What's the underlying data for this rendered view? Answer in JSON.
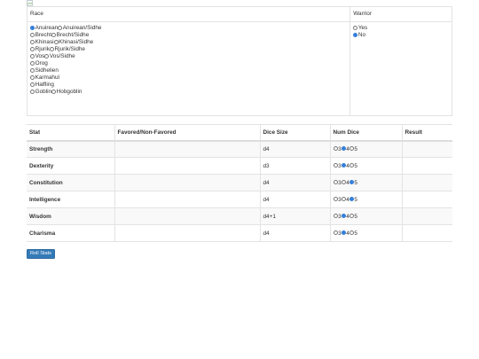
{
  "race_panel": {
    "race_header": "Race",
    "warrior_header": "Warrior",
    "race_rows": [
      [
        {
          "label": "Anuirean",
          "checked": true
        },
        {
          "label": "Anuirean/Sidhe",
          "checked": false
        }
      ],
      [
        {
          "label": "Brecht",
          "checked": false
        },
        {
          "label": "Brecht/Sidhe",
          "checked": false
        }
      ],
      [
        {
          "label": "Khinasi",
          "checked": false
        },
        {
          "label": "Khinasi/Sidhe",
          "checked": false
        }
      ],
      [
        {
          "label": "Rjurik",
          "checked": false
        },
        {
          "label": "Rjurik/Sidhe",
          "checked": false
        }
      ],
      [
        {
          "label": "Vos",
          "checked": false
        },
        {
          "label": "Vos/Sidhe",
          "checked": false
        }
      ],
      [
        {
          "label": "Orog",
          "checked": false
        }
      ],
      [
        {
          "label": "Sidhelien",
          "checked": false
        }
      ],
      [
        {
          "label": "Karmahul",
          "checked": false
        }
      ],
      [
        {
          "label": "Halfling",
          "checked": false
        }
      ],
      [
        {
          "label": "Goblin",
          "checked": false
        },
        {
          "label": "Hobgoblin",
          "checked": false
        }
      ]
    ],
    "warrior_options": [
      {
        "label": "Yes",
        "checked": false
      },
      {
        "label": "No",
        "checked": true
      }
    ]
  },
  "stats_table": {
    "headers": [
      "Stat",
      "Favored/Non-Favored",
      "Dice Size",
      "Num Dice",
      "Result"
    ],
    "rows": [
      {
        "stat": "Strength",
        "favored": "",
        "dice": "d4",
        "num_options": [
          "3",
          "4",
          "5"
        ],
        "selected": "4",
        "result": ""
      },
      {
        "stat": "Dexterity",
        "favored": "",
        "dice": "d3",
        "num_options": [
          "3",
          "4",
          "5"
        ],
        "selected": "4",
        "result": ""
      },
      {
        "stat": "Constitution",
        "favored": "",
        "dice": "d4",
        "num_options": [
          "3",
          "4",
          "5"
        ],
        "selected": "5",
        "result": ""
      },
      {
        "stat": "Intelligence",
        "favored": "",
        "dice": "d4",
        "num_options": [
          "3",
          "4",
          "5"
        ],
        "selected": "5",
        "result": ""
      },
      {
        "stat": "Wisdom",
        "favored": "",
        "dice": "d4+1",
        "num_options": [
          "3",
          "4",
          "5"
        ],
        "selected": "4",
        "result": ""
      },
      {
        "stat": "Charisma",
        "favored": "",
        "dice": "d4",
        "num_options": [
          "3",
          "4",
          "5"
        ],
        "selected": "4",
        "result": ""
      }
    ]
  },
  "roll_button_label": "Roll Stats",
  "colors": {
    "accent": "#337ab7",
    "radio_checked": "#2f7bd9",
    "border": "#e3e3e3"
  }
}
